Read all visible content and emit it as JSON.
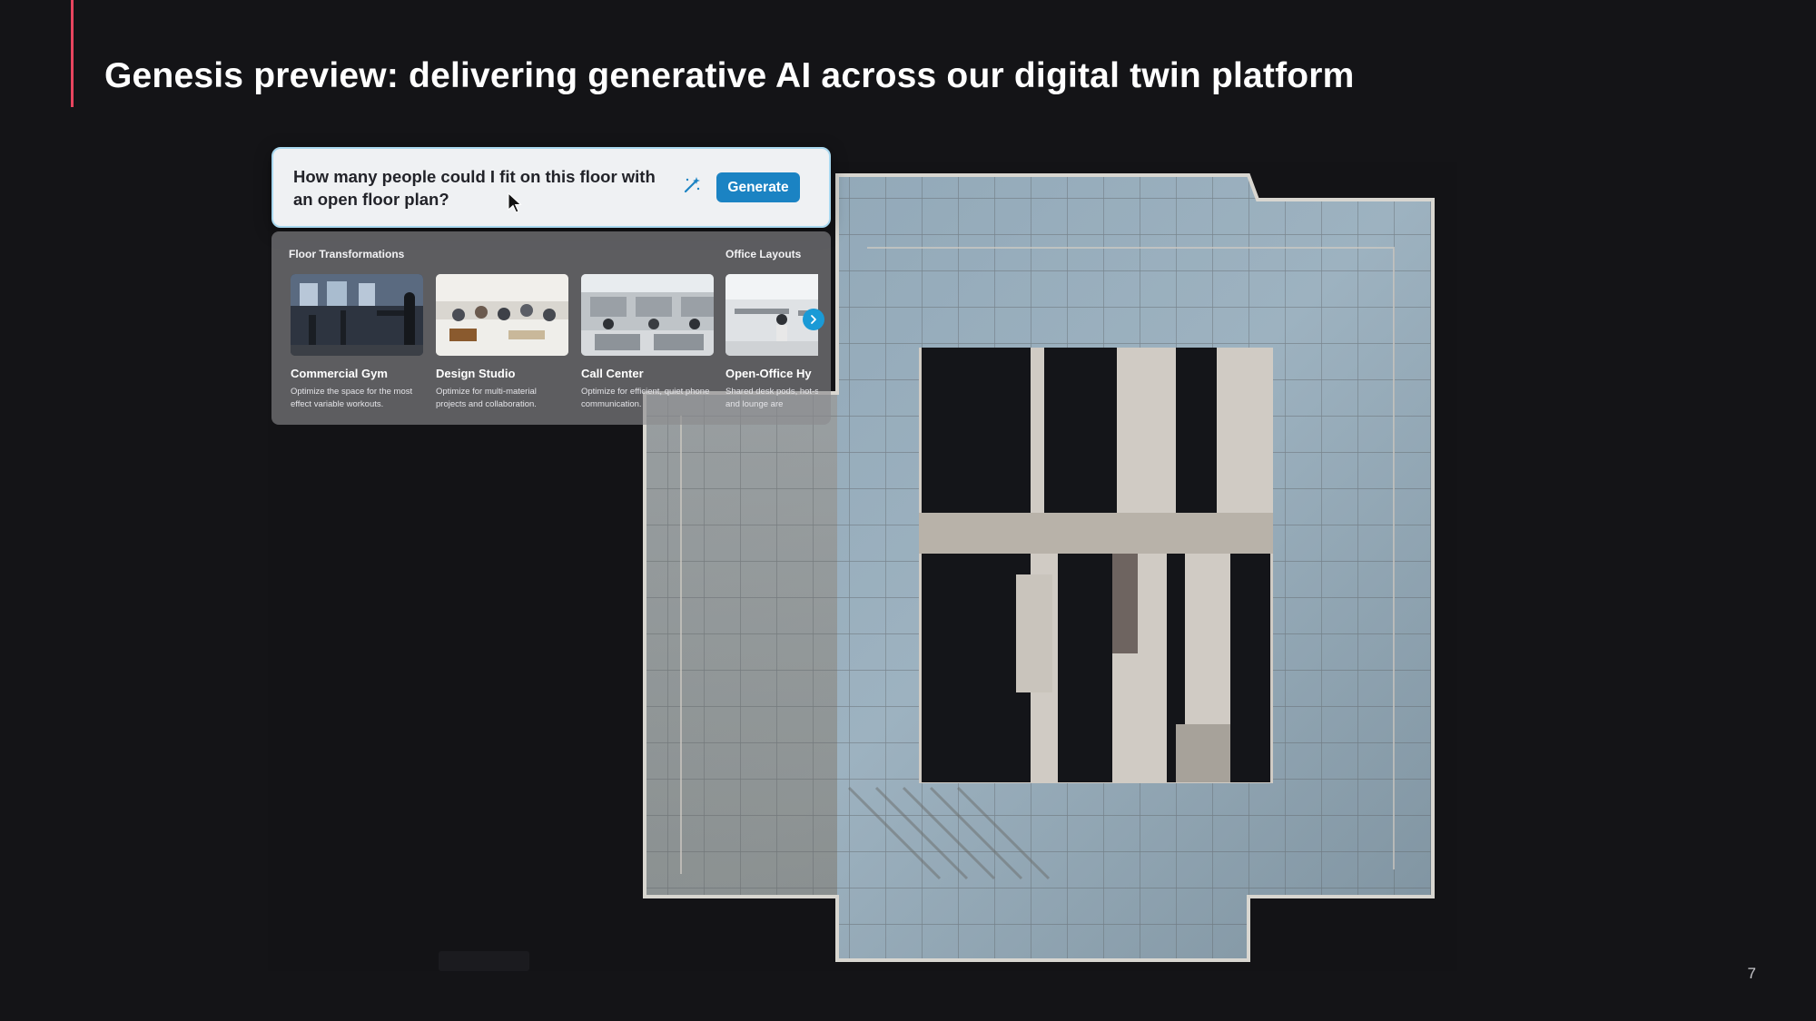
{
  "slide": {
    "title": "Genesis preview:  delivering generative AI across our digital twin platform",
    "page_number": "7",
    "accent_color": "#e8455f"
  },
  "prompt": {
    "text": "How many people could I fit on this floor with an open floor plan?",
    "generate_label": "Generate",
    "button_color": "#1b83c3",
    "icon": "magic-wand-icon"
  },
  "suggestions": {
    "floor_label": "Floor Transformations",
    "office_label": "Office Layouts",
    "cards": [
      {
        "title": "Commercial Gym",
        "description": "Optimize the space for the most effect variable workouts."
      },
      {
        "title": "Design Studio",
        "description": "Optimize for multi-material projects and collaboration."
      },
      {
        "title": "Call Center",
        "description": "Optimize for efficient, quiet phone communication."
      },
      {
        "title": "Open-Office Hy",
        "description": "Shared desk pods, hot-spaces, and lounge are"
      }
    ],
    "next_icon": "chevron-right-icon"
  }
}
